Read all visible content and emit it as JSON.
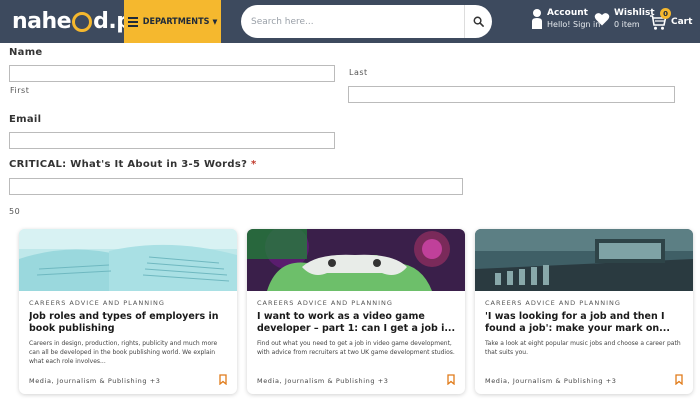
{
  "header": {
    "logo_text_1": "nahe",
    "logo_text_2": "d",
    "logo_text_3": ".pk",
    "departments_label": "DEPARTMENTS",
    "search_placeholder": "Search here...",
    "account_title": "Account",
    "account_sub": "Hello! Sign in",
    "wishlist_title": "Wishlist",
    "wishlist_sub": "0 item",
    "cart_count": "0",
    "cart_label": "Cart"
  },
  "form": {
    "name_label": "Name",
    "first_sub": "First",
    "last_sub": "Last",
    "email_label": "Email",
    "critical_label": "CRITICAL: What's It About in 3-5 Words?",
    "required_marker": "*",
    "count_text": "50"
  },
  "cards": [
    {
      "category": "CAREERS ADVICE AND PLANNING",
      "title": "Job roles and types of employers in book publishing",
      "description": "Careers in design, production, rights, publicity and much more can all be developed in the book publishing world. We explain what each role involves...",
      "tags": "Media, Journalism & Publishing +3"
    },
    {
      "category": "CAREERS ADVICE AND PLANNING",
      "title": "I want to work as a video game developer – part 1: can I get a job i...",
      "description": "Find out what you need to get a job in video game development, with advice from recruiters at two UK game development studios.",
      "tags": "Media, Journalism & Publishing +3"
    },
    {
      "category": "CAREERS ADVICE AND PLANNING",
      "title": "'I was looking for a job and then I found a job': make your mark on...",
      "description": "Take a look at eight popular music jobs and choose a career path that suits you.",
      "tags": "Media, Journalism & Publishing +3"
    }
  ],
  "colors": {
    "header_bg": "#3d4a5e",
    "accent": "#f5b82e",
    "bookmark": "#e07b1a"
  },
  "icons": [
    "search-icon",
    "account-icon",
    "heart-icon",
    "cart-icon",
    "menu-icon",
    "bookmark-icon"
  ]
}
